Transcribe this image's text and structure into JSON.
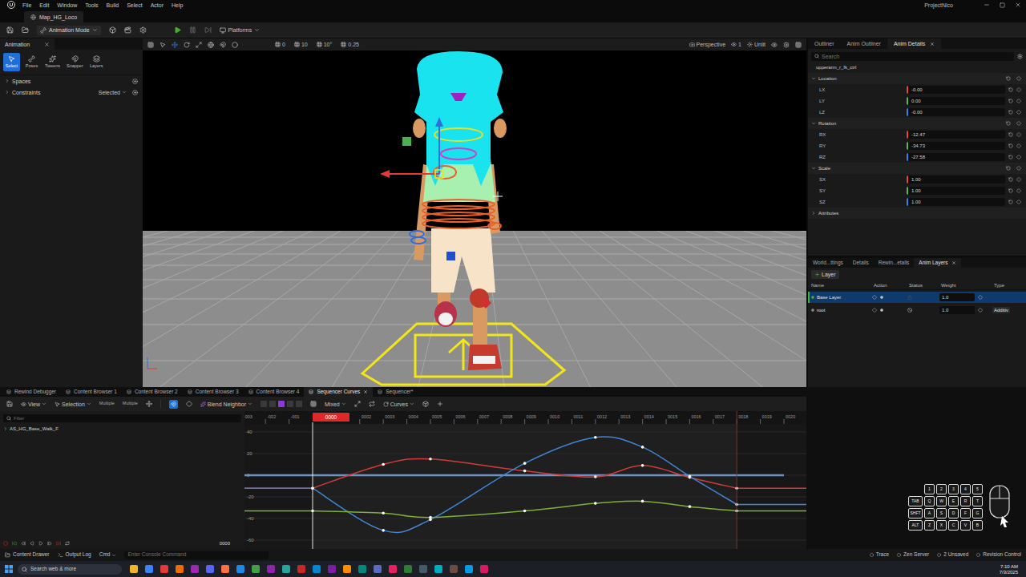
{
  "window": {
    "title": "ProjectNico",
    "menu": [
      "File",
      "Edit",
      "Window",
      "Tools",
      "Build",
      "Select",
      "Actor",
      "Help"
    ]
  },
  "level_tab": {
    "label": "Map_HG_Loco"
  },
  "toolbar": {
    "mode": "Animation Mode",
    "platforms": "Platforms"
  },
  "animation_panel": {
    "tab": "Animation",
    "tools": [
      {
        "label": "Select",
        "selected": true
      },
      {
        "label": "Poses",
        "selected": false
      },
      {
        "label": "Tweens",
        "selected": false
      },
      {
        "label": "Snapper",
        "selected": false
      },
      {
        "label": "Layers",
        "selected": false
      }
    ],
    "sections": [
      {
        "label": "Spaces",
        "dropdown": null
      },
      {
        "label": "Constraints",
        "dropdown": "Selected"
      }
    ]
  },
  "viewport": {
    "toolbar_values": [
      "0",
      "10",
      "10°",
      "0.25"
    ],
    "view": "Perspective",
    "view_count": "1",
    "lighting": "Unlit"
  },
  "details": {
    "tabs": [
      {
        "label": "Outliner",
        "selected": false
      },
      {
        "label": "Anim Outliner",
        "selected": false
      },
      {
        "label": "Anim Details",
        "selected": true
      }
    ],
    "search": {
      "placeholder": "Search"
    },
    "object": "upperarm_r_fk_ctrl",
    "groups": [
      {
        "label": "Location",
        "fields": [
          {
            "label": "LX",
            "value": "-0.00",
            "color": "#e0453a"
          },
          {
            "label": "LY",
            "value": "0.00",
            "color": "#5ab552"
          },
          {
            "label": "LZ",
            "value": "-0.00",
            "color": "#3f7fe0"
          }
        ]
      },
      {
        "label": "Rotation",
        "fields": [
          {
            "label": "RX",
            "value": "-12.47",
            "color": "#e0453a"
          },
          {
            "label": "RY",
            "value": "-34.73",
            "color": "#5ab552"
          },
          {
            "label": "RZ",
            "value": "-27.58",
            "color": "#3f7fe0"
          }
        ]
      },
      {
        "label": "Scale",
        "fields": [
          {
            "label": "SX",
            "value": "1.00",
            "color": "#e0453a"
          },
          {
            "label": "SY",
            "value": "1.00",
            "color": "#5ab552"
          },
          {
            "label": "SZ",
            "value": "1.00",
            "color": "#3f7fe0"
          }
        ]
      }
    ],
    "collapsed": [
      "Attributes"
    ]
  },
  "layers": {
    "tabs": [
      {
        "label": "World...ttings",
        "selected": false
      },
      {
        "label": "Details",
        "selected": false
      },
      {
        "label": "Rewin...etails",
        "selected": false
      },
      {
        "label": "Anim Layers",
        "selected": true
      }
    ],
    "add_button": "Layer",
    "columns": [
      "Name",
      "Action",
      "Status",
      "Weight",
      "Type"
    ],
    "rows": [
      {
        "name": "Base Layer",
        "weight": "1.0",
        "type": null,
        "selected": true,
        "active": true,
        "excluded": false
      },
      {
        "name": "root",
        "weight": "1.0",
        "type": "Additiv",
        "selected": false,
        "active": false,
        "excluded": true
      }
    ]
  },
  "bottom_tabs": [
    {
      "label": "Rewind Debugger",
      "selected": false,
      "closable": false
    },
    {
      "label": "Content Browser 1",
      "selected": false,
      "closable": false
    },
    {
      "label": "Content Browser 2",
      "selected": false,
      "closable": false
    },
    {
      "label": "Content Browser 3",
      "selected": false,
      "closable": false
    },
    {
      "label": "Content Browser 4",
      "selected": false,
      "closable": false
    },
    {
      "label": "Sequencer Curves",
      "selected": true,
      "closable": true
    },
    {
      "label": "Sequencer*",
      "selected": false,
      "closable": false
    }
  ],
  "curve_toolbar": {
    "view": "View",
    "selection": "Selection",
    "options": [
      "Multiple",
      "Multiple"
    ],
    "blend": "Blend Neighbor",
    "tangent": "Mixed",
    "curves": "Curves"
  },
  "curve_tree": {
    "filter_placeholder": "Filter",
    "items": [
      "AS_HG_Base_Walk_F"
    ]
  },
  "playback": {
    "frame": "0000"
  },
  "chart": {
    "playhead": "0000",
    "playback_range": [
      0,
      18
    ],
    "frame_labels": [
      "-003",
      "-002",
      "-001",
      "0002",
      "0003",
      "0004",
      "0005",
      "0006",
      "0007",
      "0008",
      "0009",
      "0010",
      "0011",
      "0012",
      "0013",
      "0014",
      "0015",
      "0016",
      "0017",
      "0018",
      "0019",
      "0020"
    ],
    "value_labels": [
      "40",
      "20",
      "0",
      "-20",
      "-40",
      "-60"
    ],
    "series": [
      {
        "color": "#6d93c4",
        "keys": false,
        "frames": [
          -3,
          20
        ],
        "values": [
          0,
          0
        ]
      },
      {
        "color": "#d23b3b",
        "keys": true,
        "frames": [
          0,
          3,
          5,
          9,
          12,
          14,
          16,
          18
        ],
        "values": [
          -12,
          10,
          15,
          4,
          -1.5,
          9,
          -2,
          -12
        ]
      },
      {
        "color": "#3f86d6",
        "keys": true,
        "frames": [
          0,
          3,
          5,
          9,
          12,
          14,
          16,
          18
        ],
        "values": [
          -12,
          -51,
          -41,
          11,
          35,
          26,
          -1,
          -27
        ]
      },
      {
        "color": "#7fb03a",
        "keys": true,
        "frames": [
          0,
          3,
          5,
          9,
          12,
          14,
          16,
          18
        ],
        "values": [
          -33,
          -35,
          -39,
          -33,
          -26,
          -24,
          -29,
          -33
        ]
      }
    ]
  },
  "status_bar": {
    "left": [
      "Content Drawer",
      "Output Log",
      "Cmd"
    ],
    "console_placeholder": "Enter Console Command",
    "right": [
      "Trace",
      "Zen Server",
      "2 Unsaved",
      "Revision Control"
    ]
  },
  "taskbar": {
    "search": "Search web & more",
    "time": "7:10 AM",
    "date": "7/3/2025"
  },
  "key_overlay": {
    "rows": [
      [
        "1",
        "2",
        "3",
        "4",
        "5"
      ],
      [
        "TAB",
        "Q",
        "W",
        "E",
        "R",
        "T"
      ],
      [
        "SHFT",
        "A",
        "S",
        "D",
        "F",
        "G"
      ],
      [
        "ALT",
        "Z",
        "X",
        "C",
        "V",
        "B"
      ]
    ]
  }
}
